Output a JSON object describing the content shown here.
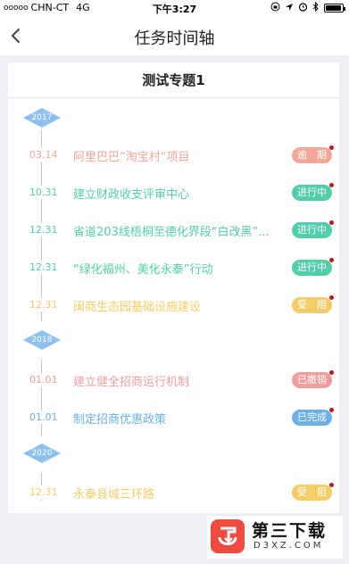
{
  "status_bar": {
    "dots": "ooooo",
    "carrier": "CHN-CT",
    "network": "4G",
    "time": "下午3:27"
  },
  "nav": {
    "title": "任务时间轴"
  },
  "card": {
    "title": "测试专题1"
  },
  "colors": {
    "overdue": "#f2a79a",
    "in_progress": "#52cfa9",
    "blocked": "#f4cd66",
    "cancelled": "#ef9d9d",
    "completed": "#6cb0e4",
    "year_marker": "#8ec0ee"
  },
  "years": [
    "2017",
    "2018",
    "2020"
  ],
  "events": [
    {
      "date": "03.14",
      "text": "阿里巴巴”淘宝村“项目",
      "status": "逾　期",
      "color": "#f2a79a"
    },
    {
      "date": "10.31",
      "text": "建立财政收支评审中心",
      "status": "进行中",
      "color": "#52cfa9"
    },
    {
      "date": "12.31",
      "text": "省道203线梧桐至德化界段“白改黑”...",
      "status": "进行中",
      "color": "#52cfa9"
    },
    {
      "date": "12.31",
      "text": "“绿化福州、美化永泰”行动",
      "status": "进行中",
      "color": "#52cfa9"
    },
    {
      "date": "12.31",
      "text": "闽商生态园基础设施建设",
      "status": "受　阻",
      "color": "#f4cd66"
    },
    {
      "date": "01.01",
      "text": "建立健全招商运行机制",
      "status": "已撤销",
      "color": "#ef9d9d"
    },
    {
      "date": "01.01",
      "text": "制定招商优惠政策",
      "status": "已完成",
      "color": "#6cb0e4"
    },
    {
      "date": "12.31",
      "text": "永泰县城三环路",
      "status": "受　阻",
      "color": "#f4cd66"
    }
  ],
  "watermark": {
    "title": "第三下载",
    "domain": "D3XZ.COM"
  }
}
